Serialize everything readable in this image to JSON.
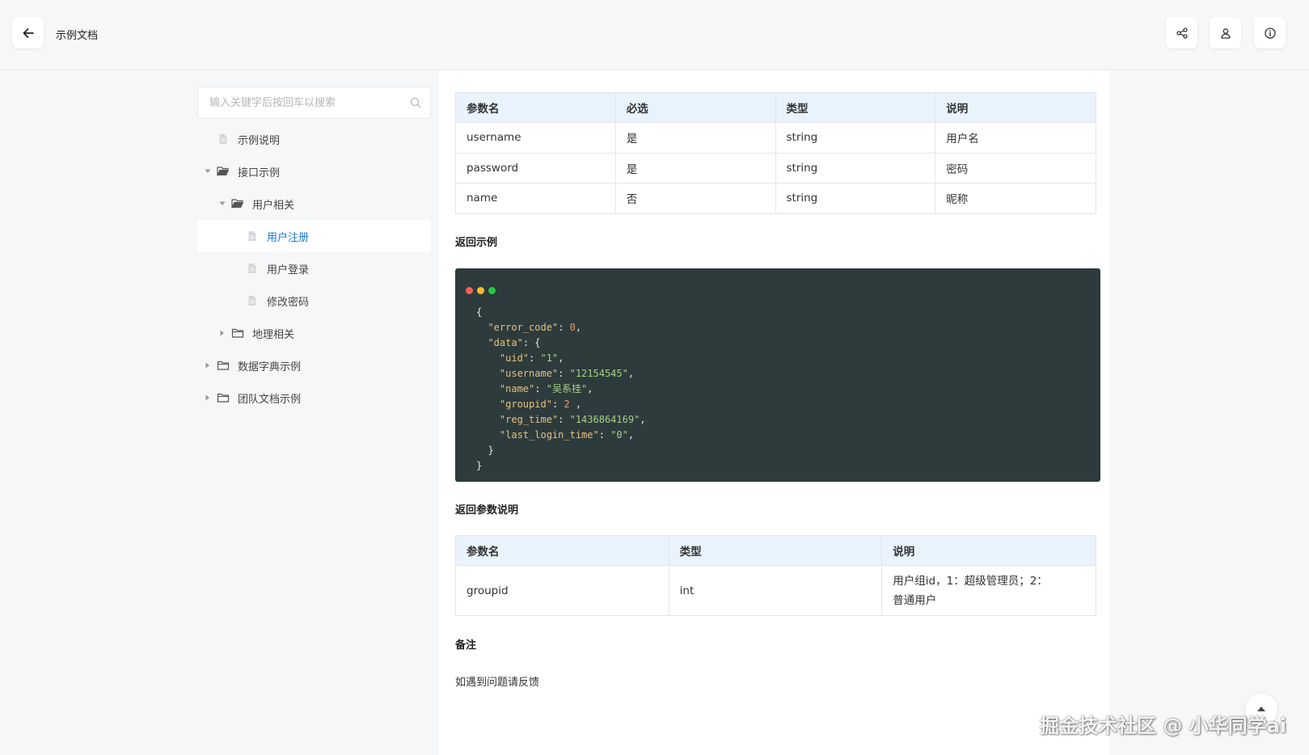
{
  "header": {
    "title": "示例文档"
  },
  "icons": {
    "back": "arrow-left-icon",
    "share": "share-icon",
    "user": "user-icon",
    "info": "info-icon",
    "search": "search-icon",
    "file": "file-icon",
    "folder_open": "folder-open-icon",
    "folder": "folder-icon",
    "caret_down": "caret-down-icon",
    "caret_right": "caret-right-icon",
    "to_top": "arrow-up-icon"
  },
  "sidebar": {
    "search_placeholder": "输入关键字后按回车以搜索",
    "items": [
      {
        "label": "示例说明",
        "level": 0,
        "type": "file"
      },
      {
        "label": "接口示例",
        "level": 0,
        "type": "folder",
        "expanded": true
      },
      {
        "label": "用户相关",
        "level": 1,
        "type": "folder",
        "expanded": true
      },
      {
        "label": "用户注册",
        "level": 2,
        "type": "file",
        "active": true
      },
      {
        "label": "用户登录",
        "level": 2,
        "type": "file"
      },
      {
        "label": "修改密码",
        "level": 2,
        "type": "file"
      },
      {
        "label": "地理相关",
        "level": 1,
        "type": "folder",
        "expanded": false
      },
      {
        "label": "数据字典示例",
        "level": 0,
        "type": "folder",
        "expanded": false
      },
      {
        "label": "团队文档示例",
        "level": 0,
        "type": "folder",
        "expanded": false
      }
    ]
  },
  "params_table": {
    "headers": [
      "参数名",
      "必选",
      "类型",
      "说明"
    ],
    "rows": [
      [
        "username",
        "是",
        "string",
        "用户名"
      ],
      [
        "password",
        "是",
        "string",
        "密码"
      ],
      [
        "name",
        "否",
        "string",
        "昵称"
      ]
    ]
  },
  "return_example": {
    "title": "返回示例",
    "lines": [
      "{",
      "  \"error_code\": 0,",
      "  \"data\": {",
      "    \"uid\": \"1\",",
      "    \"username\": \"12154545\",",
      "    \"name\": \"吴系挂\",",
      "    \"groupid\": 2 ,",
      "    \"reg_time\": \"1436864169\",",
      "    \"last_login_time\": \"0\",",
      "  }",
      "}"
    ]
  },
  "return_params": {
    "title": "返回参数说明",
    "headers": [
      "参数名",
      "类型",
      "说明"
    ],
    "rows": [
      [
        "groupid",
        "int",
        "用户组id，1：超级管理员；2：普通用户"
      ]
    ]
  },
  "remark": {
    "title": "备注",
    "text": "如遇到问题请反馈"
  },
  "watermark": "掘金技术社区 @ 小华同学ai",
  "colors": {
    "accent": "#1a78d6",
    "code_bg": "#2d3b3c",
    "table_header_bg": "#e9f3fd",
    "dot_red": "#ff5f57",
    "dot_yellow": "#febc2e",
    "dot_green": "#28c840"
  }
}
